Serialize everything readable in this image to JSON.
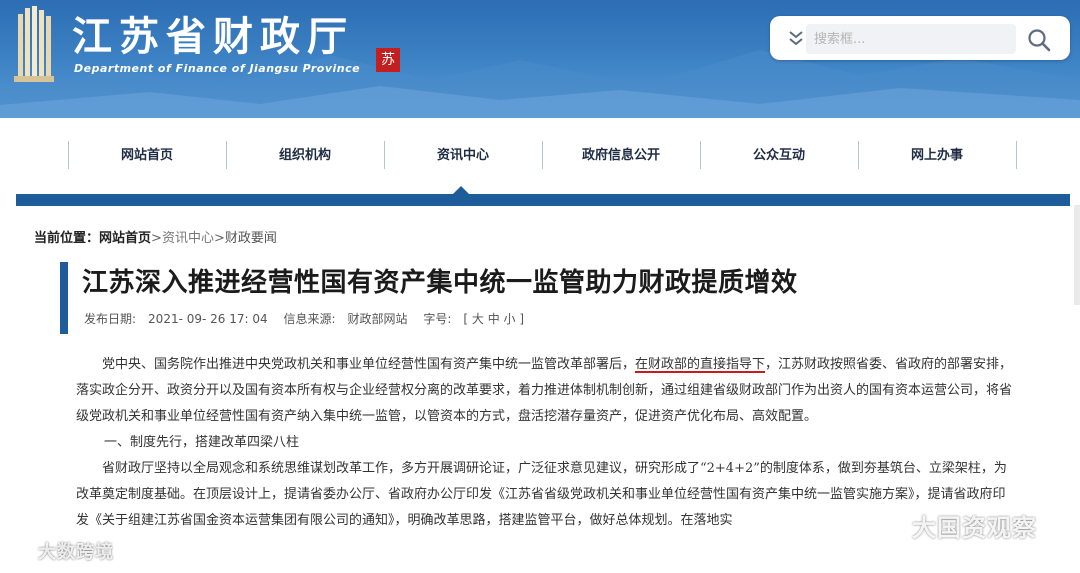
{
  "header": {
    "site_title": "江苏省财政厅",
    "site_subtitle": "Department of Finance of Jiangsu Province",
    "seal_text": "苏",
    "search_placeholder": "搜索框..."
  },
  "nav": {
    "items": [
      {
        "label": "网站首页"
      },
      {
        "label": "组织机构"
      },
      {
        "label": "资讯中心"
      },
      {
        "label": "政府信息公开"
      },
      {
        "label": "公众互动"
      },
      {
        "label": "网上办事"
      }
    ],
    "active_index": 2
  },
  "breadcrumb": {
    "lead": "当前位置：",
    "home": "网站首页",
    "sep1": ">",
    "level2": "资讯中心",
    "sep2": ">",
    "current": "财政要闻"
  },
  "article": {
    "title": "江苏深入推进经营性国有资产集中统一监管助力财政提质增效",
    "meta": {
      "date_label": "发布日期:",
      "date_value": "2021- 09- 26   17: 04",
      "source_label": "信息来源:",
      "source_value": "财政部网站",
      "fontsize_label": "字号:",
      "fontsize_options": "[ 大 中 小 ]"
    },
    "para1_part1": "党中央、国务院作出推进中央党政机关和事业单位经营性国有资产集中统一监管改革部署后，",
    "para1_highlight": "在财政部的直接指导下",
    "para1_part2": "，江苏财政按照省委、省政府的部署安排，落实政企分开、政资分开以及国有资本所有权与企业经营权分离的改革要求，着力推进体制机制创新，通过组建省级财政部门作为出资人的国有资本运营公司，将省级党政机关和事业单位经营性国有资产纳入集中统一监管，以管资本的方式，盘活挖潜存量资产，促进资产优化布局、高效配置。",
    "section1_heading": "一、制度先行，搭建改革四梁八柱",
    "para2": "省财政厅坚持以全局观念和系统思维谋划改革工作，多方开展调研论证，广泛征求意见建议，研究形成了“2+4+2”的制度体系，做到夯基筑台、立梁架柱，为改革奠定制度基础。在顶层设计上，提请省委办公厅、省政府办公厅印发《江苏省省级党政机关和事业单位经营性国有资产集中统一监管实施方案》，提请省政府印发《关于组建江苏省国金资本运营集团有限公司的通知》，明确改革思路，搭建监管平台，做好总体规划。在落地实"
  },
  "watermarks": {
    "left": "大数跨境",
    "right": "大国资观察"
  },
  "colors": {
    "header_blue": "#2c6db3",
    "nav_bar_blue": "#1e5d9a",
    "title_accent": "#1e5d9a",
    "underline_red": "#cc1a1a"
  }
}
